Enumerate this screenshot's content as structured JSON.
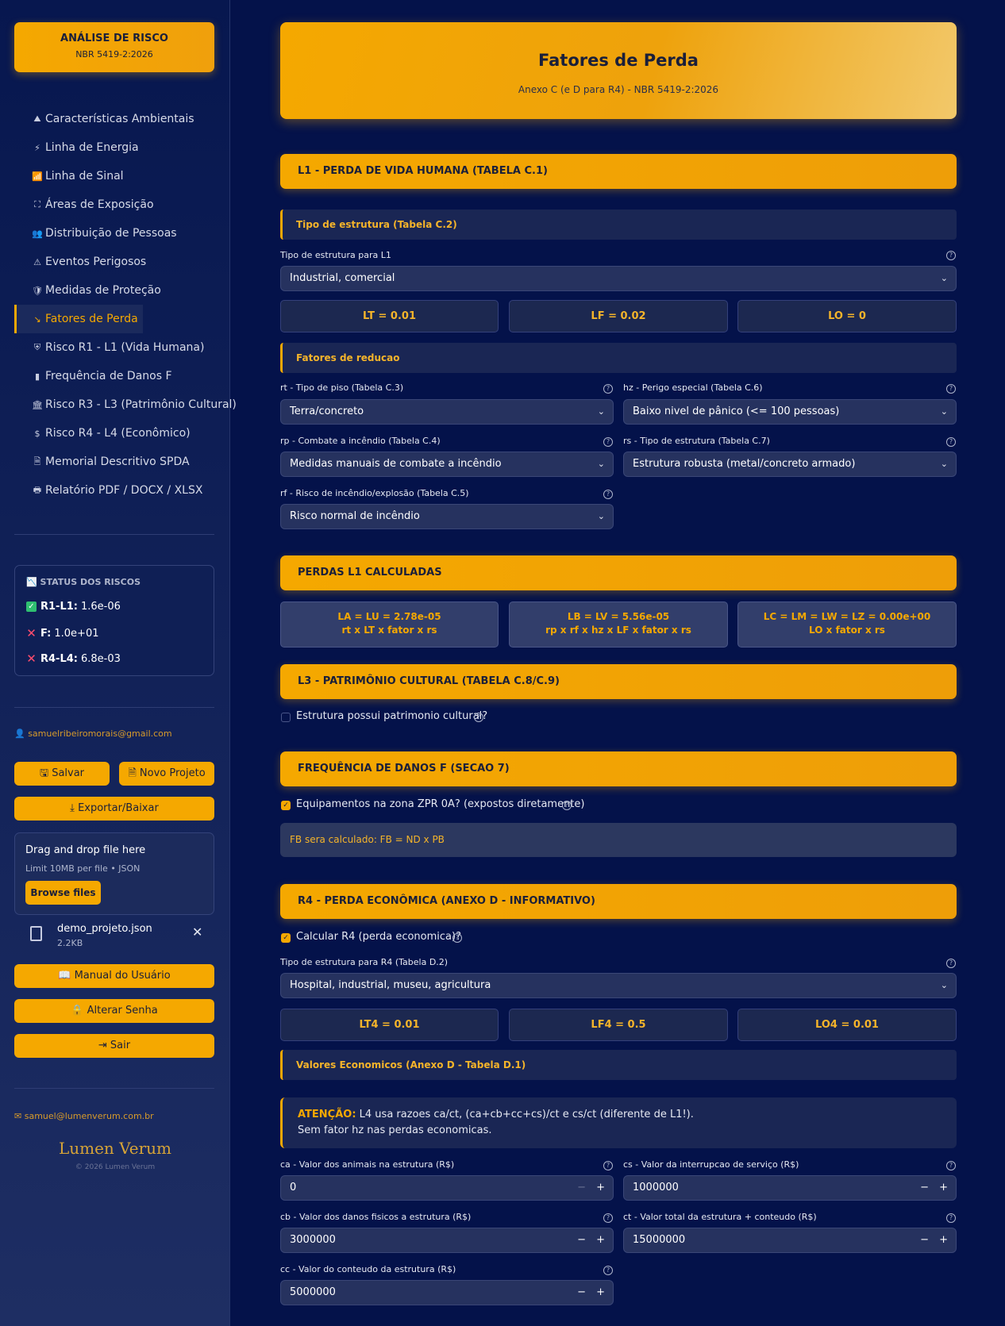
{
  "sidebar": {
    "brand_title": "ANÁLISE DE RISCO",
    "brand_subtitle": "NBR 5419-2:2026",
    "nav": [
      {
        "icon": "⛰",
        "label": "Características Ambientais"
      },
      {
        "icon": "⚡",
        "label": "Linha de Energia"
      },
      {
        "icon": "📶",
        "label": "Linha de Sinal"
      },
      {
        "icon": "⛶",
        "label": "Áreas de Exposição"
      },
      {
        "icon": "👥",
        "label": "Distribuição de Pessoas"
      },
      {
        "icon": "⚠",
        "label": "Eventos Perigosos"
      },
      {
        "icon": "🛡",
        "label": "Medidas de Proteção"
      },
      {
        "icon": "↘",
        "label": "Fatores de Perda"
      },
      {
        "icon": "⛨",
        "label": "Risco R1 - L1 (Vida Humana)"
      },
      {
        "icon": "▮",
        "label": "Frequência de Danos F"
      },
      {
        "icon": "🏛",
        "label": "Risco R3 - L3 (Patrimônio Cultural)"
      },
      {
        "icon": "$",
        "label": "Risco R4 - L4 (Econômico)"
      },
      {
        "icon": "🗎",
        "label": "Memorial Descritivo SPDA"
      },
      {
        "icon": "🖶",
        "label": "Relatório PDF / DOCX / XLSX"
      }
    ],
    "active_index": 7,
    "status": {
      "title": "STATUS DOS RISCOS",
      "title_icon": "📉",
      "rows": [
        {
          "key": "R1-L1:",
          "value": "1.6e-06",
          "ok": true
        },
        {
          "key": "F:",
          "value": "1.0e+01",
          "ok": false
        },
        {
          "key": "R4-L4:",
          "value": "6.8e-03",
          "ok": false
        }
      ]
    },
    "user_email": "samuelribeiromorais@gmail.com",
    "buttons": {
      "save": "Salvar",
      "new_project": "Novo Projeto",
      "export": "Exportar/Baixar",
      "manual": "Manual do Usuário",
      "change_password": "Alterar Senha",
      "logout": "Sair"
    },
    "upload": {
      "title": "Drag and drop file here",
      "limit": "Limit 10MB per file • JSON",
      "browse": "Browse files"
    },
    "file": {
      "name": "demo_projeto.json",
      "size": "2.2KB"
    },
    "contact_email": "samuel@lumenverum.com.br",
    "logo": "Lumen Verum",
    "copyright": "© 2026 Lumen Verum"
  },
  "main": {
    "title": "Fatores de Perda",
    "subtitle": "Anexo C (e D para R4) - NBR 5419-2:2026",
    "l1": {
      "band": "L1 - PERDA DE VIDA HUMANA (TABELA C.1)",
      "structure_sub": "Tipo de estrutura (Tabela C.2)",
      "structure_label": "Tipo de estrutura para L1",
      "structure_value": "Industrial, comercial",
      "lt": "LT = 0.01",
      "lf": "LF = 0.02",
      "lo": "LO = 0",
      "reduction_sub": "Fatores de reducao",
      "rt_label": "rt - Tipo de piso (Tabela C.3)",
      "rt_value": "Terra/concreto",
      "hz_label": "hz - Perigo especial (Tabela C.6)",
      "hz_value": "Baixo nivel de pânico (<= 100 pessoas)",
      "rp_label": "rp - Combate a incêndio (Tabela C.4)",
      "rp_value": "Medidas manuais de combate a incêndio",
      "rs_label": "rs - Tipo de estrutura (Tabela C.7)",
      "rs_value": "Estrutura robusta (metal/concreto armado)",
      "rf_label": "rf - Risco de incêndio/explosão (Tabela C.5)",
      "rf_value": "Risco normal de incêndio"
    },
    "losses": {
      "band": "PERDAS L1 CALCULADAS",
      "la": "LA = LU = 2.78e-05",
      "la_f": "rt x LT x fator x rs",
      "lb": "LB = LV = 5.56e-05",
      "lb_f": "rp x rf x hz x LF x fator x rs",
      "lc": "LC = LM = LW = LZ = 0.00e+00",
      "lc_f": "LO x fator x rs"
    },
    "l3": {
      "band": "L3 - PATRIMÔNIO CULTURAL (TABELA C.8/C.9)",
      "checkbox": "Estrutura possui patrimonio cultural?"
    },
    "freq": {
      "band": "FREQUÊNCIA DE DANOS F (SECAO 7)",
      "checkbox": "Equipamentos na zona ZPR 0A? (expostos diretamente)",
      "info": "FB sera calculado: FB = ND x PB"
    },
    "r4": {
      "band": "R4 - PERDA ECONÔMICA (ANEXO D - INFORMATIVO)",
      "checkbox": "Calcular R4 (perda economica)?",
      "structure_label": "Tipo de estrutura para R4 (Tabela D.2)",
      "structure_value": "Hospital, industrial, museu, agricultura",
      "lt4": "LT4 = 0.01",
      "lf4": "LF4 = 0.5",
      "lo4": "LO4 = 0.01",
      "econ_sub": "Valores Economicos (Anexo D - Tabela D.1)",
      "warn_key": "ATENÇÃO:",
      "warn_line1": " L4 usa razoes ca/ct, (ca+cb+cc+cs)/ct e cs/ct (diferente de L1!).",
      "warn_line2": "Sem fator hz nas perdas economicas.",
      "ca_label": "ca - Valor dos animais na estrutura (R$)",
      "ca_value": "0",
      "cs_label": "cs - Valor da interrupcao de serviço (R$)",
      "cs_value": "1000000",
      "cb_label": "cb - Valor dos danos fisicos a estrutura (R$)",
      "cb_value": "3000000",
      "ct_label": "ct - Valor total da estrutura + conteudo (R$)",
      "ct_value": "15000000",
      "cc_label": "cc - Valor do conteudo da estrutura (R$)",
      "cc_value": "5000000"
    }
  },
  "colors": {
    "accent": "#f5a800",
    "background": "#04124a",
    "ok": "#2fbf71",
    "bad": "#ff4d6d"
  }
}
